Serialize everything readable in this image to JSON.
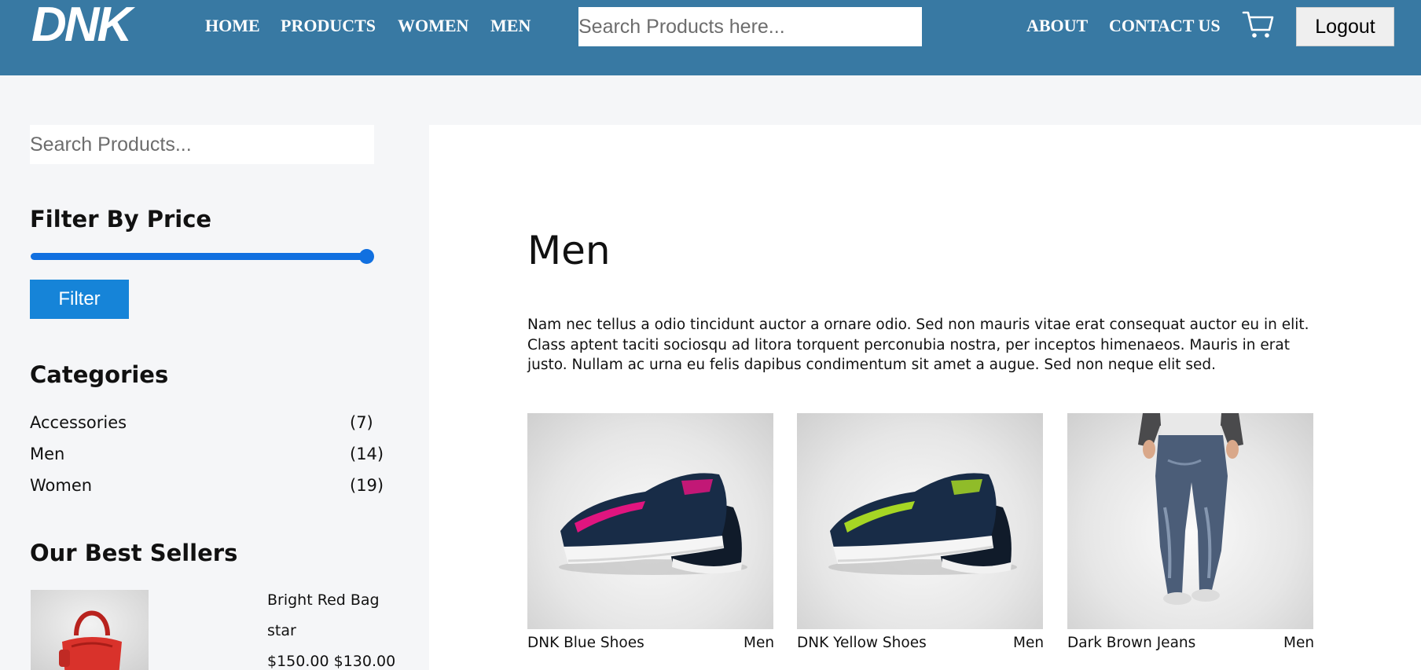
{
  "header": {
    "logo_text": "DNK",
    "nav_left": [
      "HOME",
      "PRODUCTS",
      "WOMEN",
      "MEN"
    ],
    "search_placeholder": "Search Products here...",
    "nav_right": [
      "ABOUT",
      "CONTACT US"
    ],
    "cart_icon": "shopping-cart-icon",
    "logout_label": "Logout"
  },
  "sidebar": {
    "search_placeholder": "Search Products...",
    "filter_title": "Filter By Price",
    "price_slider_level": 1.0,
    "filter_button": "Filter",
    "categories_title": "Categories",
    "categories": [
      {
        "name": "Accessories",
        "count": "(7)"
      },
      {
        "name": "Men",
        "count": "(14)"
      },
      {
        "name": "Women",
        "count": "(19)"
      }
    ],
    "best_sellers_title": "Our Best Sellers",
    "best_sellers": [
      {
        "name": "Bright Red Bag",
        "rating": "star",
        "price": "$150.00 $130.00"
      }
    ]
  },
  "main": {
    "title": "Men",
    "description": "Nam nec tellus a odio tincidunt auctor a ornare odio. Sed non mauris vitae erat consequat auctor eu in elit. Class aptent taciti sociosqu ad litora torquent perconubia nostra, per inceptos himenaeos. Mauris in erat justo. Nullam ac urna eu felis dapibus condimentum sit amet a augue. Sed non neque elit sed.",
    "products": [
      {
        "name": "DNK Blue Shoes",
        "category": "Men",
        "accent": "#e0157f"
      },
      {
        "name": "DNK Yellow Shoes",
        "category": "Men",
        "accent": "#a6d624"
      },
      {
        "name": "Dark Brown Jeans",
        "category": "Men"
      }
    ]
  },
  "colors": {
    "header_bg": "#3879a3",
    "accent_blue": "#1170e0",
    "filter_button": "#1684d8",
    "page_bg": "#f5f6f8"
  }
}
